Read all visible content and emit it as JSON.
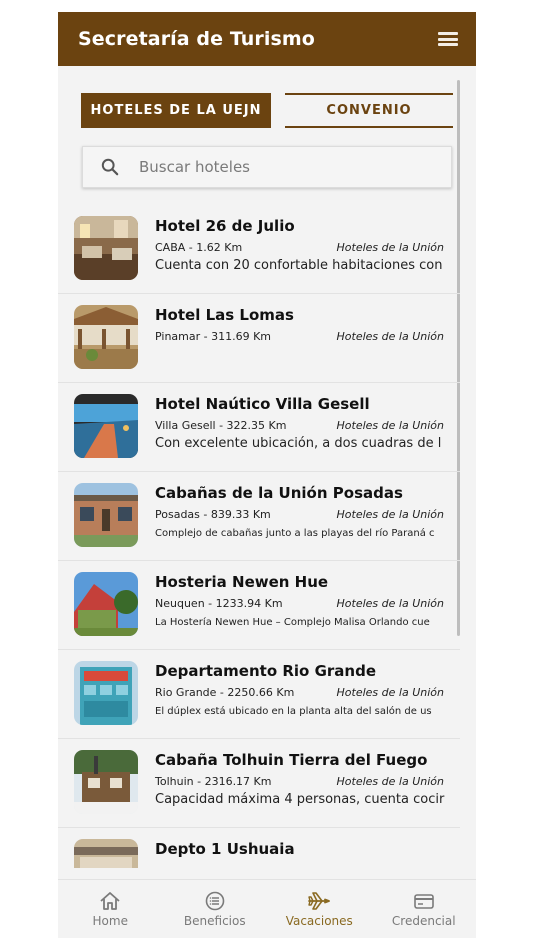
{
  "app": {
    "title": "Secretaría de Turismo",
    "menu_icon": "hamburger-menu-icon"
  },
  "tabs": [
    {
      "label": "HOTELES DE LA UEJN",
      "active": true
    },
    {
      "label": "CONVENIO",
      "active": false
    }
  ],
  "search": {
    "placeholder": "Buscar hoteles",
    "value": "",
    "icon": "search-icon"
  },
  "hotels": [
    {
      "name": "Hotel 26 de Julio",
      "location": "CABA - 1.62 Km",
      "category": "Hoteles de la Unión",
      "description": "Cuenta con 20 confortable habitaciones con"
    },
    {
      "name": "Hotel Las Lomas",
      "location": "Pinamar - 311.69 Km",
      "category": "Hoteles de la Unión",
      "description": ""
    },
    {
      "name": "Hotel Naútico Villa Gesell",
      "location": "Villa Gesell - 322.35 Km",
      "category": "Hoteles de la Unión",
      "description": "Con excelente ubicación, a dos cuadras de l"
    },
    {
      "name": "Cabañas de la Unión Posadas",
      "location": "Posadas - 839.33 Km",
      "category": "Hoteles de la Unión",
      "description": "Complejo de cabañas junto a las playas del río Paraná c"
    },
    {
      "name": "Hosteria Newen Hue",
      "location": "Neuquen - 1233.94 Km",
      "category": "Hoteles de la Unión",
      "description": "La Hostería Newen Hue – Complejo Malisa Orlando cue"
    },
    {
      "name": "Departamento Rio Grande",
      "location": "Rio Grande - 2250.66 Km",
      "category": "Hoteles de la Unión",
      "description": "El dúplex está ubicado en la planta alta del salón de us"
    },
    {
      "name": "Cabaña Tolhuin Tierra del Fuego",
      "location": "Tolhuin - 2316.17 Km",
      "category": "Hoteles de la Unión",
      "description": "Capacidad máxima 4 personas, cuenta cocir"
    },
    {
      "name": "Depto 1 Ushuaia",
      "location": "",
      "category": "",
      "description": ""
    }
  ],
  "bottom_nav": [
    {
      "label": "Home",
      "icon": "home-icon",
      "active": false
    },
    {
      "label": "Beneficios",
      "icon": "list-circle-icon",
      "active": false
    },
    {
      "label": "Vacaciones",
      "icon": "airplane-icon",
      "active": true
    },
    {
      "label": "Credencial",
      "icon": "credit-card-icon",
      "active": false
    }
  ],
  "colors": {
    "primary": "#6b4310",
    "active_nav": "#8a6a22",
    "background": "#f3f3f3"
  }
}
